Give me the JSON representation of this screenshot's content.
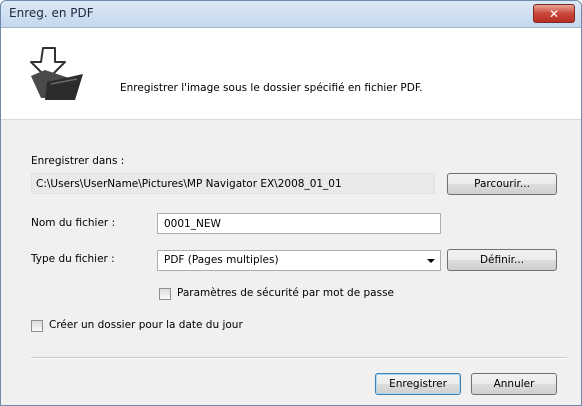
{
  "window": {
    "title": "Enreg. en PDF",
    "close_symbol": "✕"
  },
  "header": {
    "icon": "save-folder-arrow-icon",
    "description": "Enregistrer l'image sous le dossier spécifié en fichier PDF."
  },
  "save_in": {
    "label": "Enregistrer dans :",
    "path": "C:\\Users\\UserName\\Pictures\\MP Navigator EX\\2008_01_01",
    "browse_label": "Parcourir..."
  },
  "file_name": {
    "label": "Nom du fichier :",
    "value": "0001_NEW"
  },
  "file_type": {
    "label": "Type du fichier :",
    "selected": "PDF (Pages multiples)",
    "define_label": "Définir..."
  },
  "password_security": {
    "label": "Paramètres de sécurité par mot de passe",
    "checked": false
  },
  "create_date_folder": {
    "label": "Créer un dossier pour la date du jour",
    "checked": false
  },
  "footer": {
    "save_label": "Enregistrer",
    "cancel_label": "Annuler"
  }
}
